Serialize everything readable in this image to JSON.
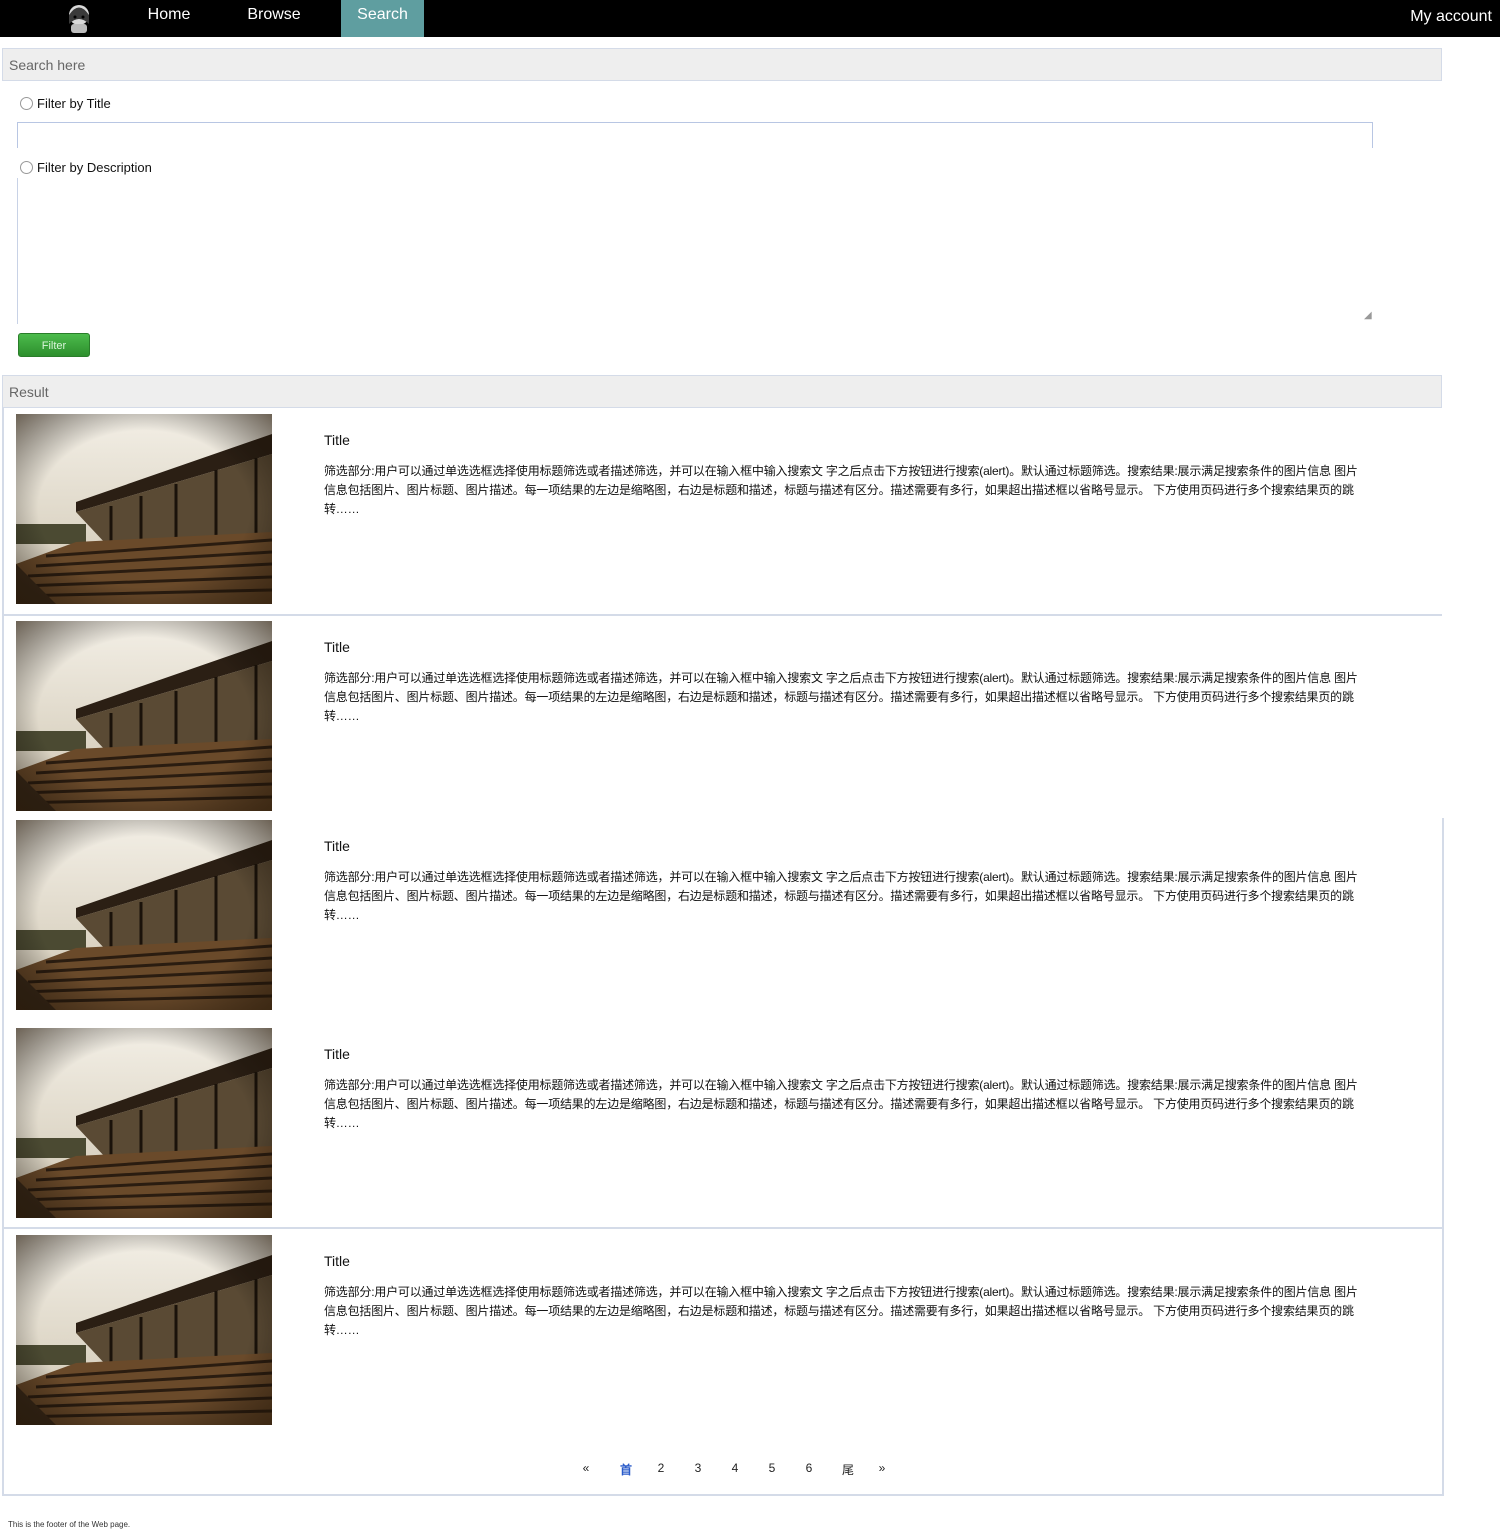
{
  "nav": {
    "items": [
      "Home",
      "Browse",
      "Search"
    ],
    "active": "Search",
    "account": "My account"
  },
  "search": {
    "header": "Search here",
    "filter_title_label": "Filter by Title",
    "filter_desc_label": "Filter by Description",
    "filter_button": "Filter"
  },
  "results": {
    "header": "Result",
    "items": [
      {
        "title": "Title",
        "description": "筛选部分:用户可以通过单选选框选择使用标题筛选或者描述筛选，并可以在输入框中输入搜索文 字之后点击下方按钮进行搜索(alert)。默认通过标题筛选。搜索结果:展示满足搜索条件的图片信息 图片信息包括图片、图片标题、图片描述。每一项结果的左边是缩略图，右边是标题和描述，标题与描述有区分。描述需要有多行，如果超出描述框以省略号显示。 下方使用页码进行多个搜索结果页的跳转……"
      },
      {
        "title": "Title",
        "description": "筛选部分:用户可以通过单选选框选择使用标题筛选或者描述筛选，并可以在输入框中输入搜索文 字之后点击下方按钮进行搜索(alert)。默认通过标题筛选。搜索结果:展示满足搜索条件的图片信息 图片信息包括图片、图片标题、图片描述。每一项结果的左边是缩略图，右边是标题和描述，标题与描述有区分。描述需要有多行，如果超出描述框以省略号显示。 下方使用页码进行多个搜索结果页的跳转……"
      },
      {
        "title": "Title",
        "description": "筛选部分:用户可以通过单选选框选择使用标题筛选或者描述筛选，并可以在输入框中输入搜索文 字之后点击下方按钮进行搜索(alert)。默认通过标题筛选。搜索结果:展示满足搜索条件的图片信息 图片信息包括图片、图片标题、图片描述。每一项结果的左边是缩略图，右边是标题和描述，标题与描述有区分。描述需要有多行，如果超出描述框以省略号显示。 下方使用页码进行多个搜索结果页的跳转……"
      },
      {
        "title": "Title",
        "description": "筛选部分:用户可以通过单选选框选择使用标题筛选或者描述筛选，并可以在输入框中输入搜索文 字之后点击下方按钮进行搜索(alert)。默认通过标题筛选。搜索结果:展示满足搜索条件的图片信息 图片信息包括图片、图片标题、图片描述。每一项结果的左边是缩略图，右边是标题和描述，标题与描述有区分。描述需要有多行，如果超出描述框以省略号显示。 下方使用页码进行多个搜索结果页的跳转……"
      },
      {
        "title": "Title",
        "description": "筛选部分:用户可以通过单选选框选择使用标题筛选或者描述筛选，并可以在输入框中输入搜索文 字之后点击下方按钮进行搜索(alert)。默认通过标题筛选。搜索结果:展示满足搜索条件的图片信息 图片信息包括图片、图片标题、图片描述。每一项结果的左边是缩略图，右边是标题和描述，标题与描述有区分。描述需要有多行，如果超出描述框以省略号显示。 下方使用页码进行多个搜索结果页的跳转……"
      }
    ]
  },
  "pagination": {
    "prev": "«",
    "pages": [
      "首",
      "2",
      "3",
      "4",
      "5",
      "6",
      "尾"
    ],
    "next": "»",
    "active_index": 0
  },
  "footer": "This is the footer of the Web page."
}
